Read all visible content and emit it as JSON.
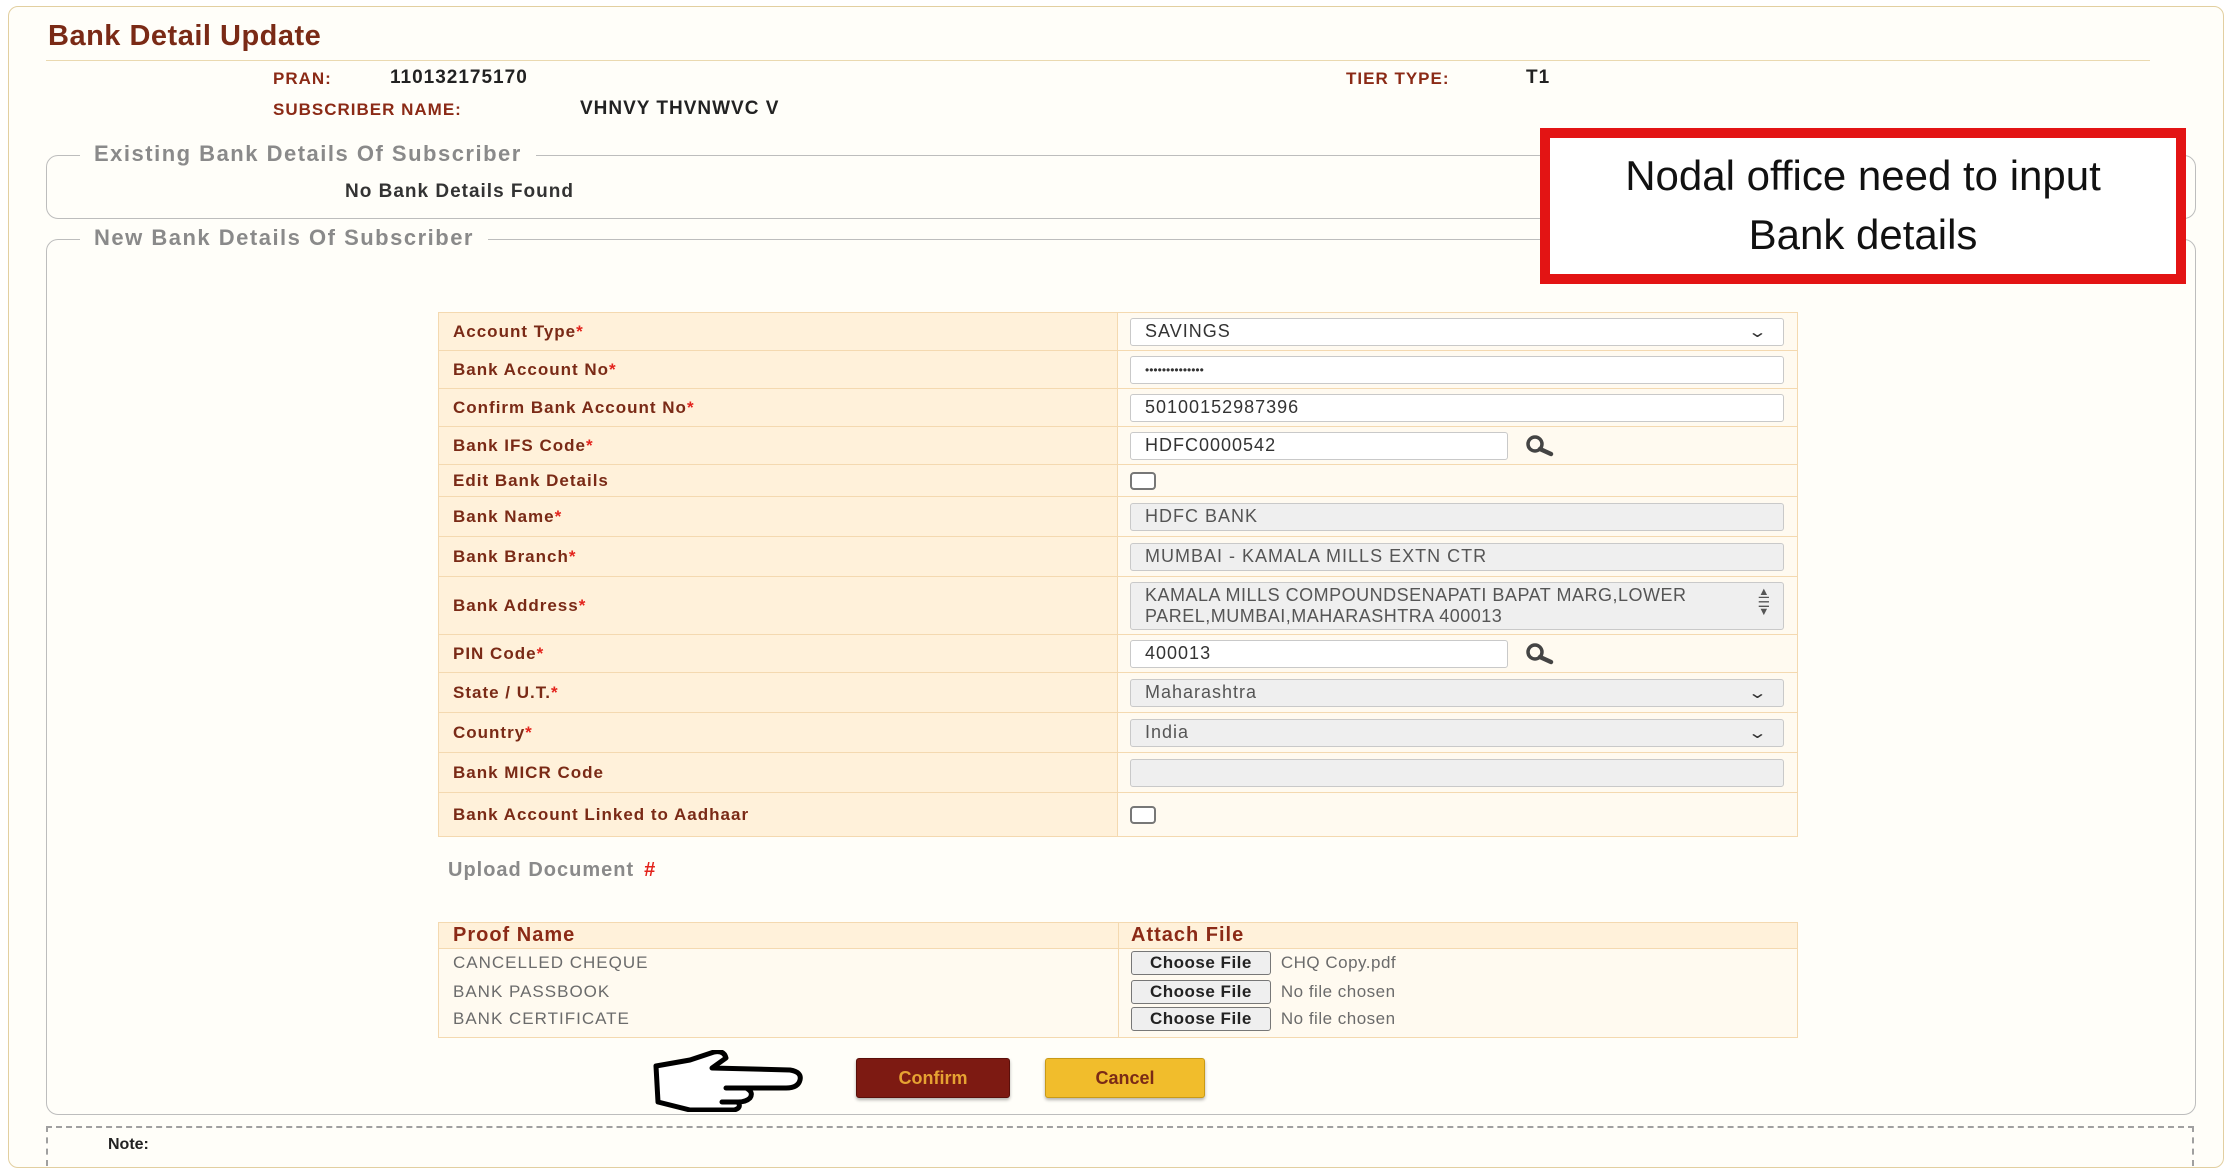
{
  "page": {
    "title": "Bank Detail Update"
  },
  "subscriber": {
    "pran_label": "PRAN:",
    "pran_value": "110132175170",
    "tier_label": "TIER TYPE:",
    "tier_value": "T1",
    "name_label": "SUBSCRIBER NAME:",
    "name_value": "VHNVY THVNWVC V"
  },
  "existing": {
    "legend": "Existing Bank Details Of Subscriber",
    "message": "No Bank Details Found"
  },
  "new_details": {
    "legend": "New Bank Details Of Subscriber"
  },
  "callout": {
    "text": "Nodal office need to input Bank details"
  },
  "form": {
    "account_type": {
      "label": "Account Type",
      "value": "SAVINGS"
    },
    "account_no": {
      "label": "Bank Account No",
      "value": "••••••••••••••"
    },
    "confirm_account_no": {
      "label": "Confirm Bank Account No",
      "value": "50100152987396"
    },
    "ifsc": {
      "label": "Bank IFS Code",
      "value": "HDFC0000542"
    },
    "edit_bank": {
      "label": "Edit Bank Details"
    },
    "bank_name": {
      "label": "Bank Name",
      "value": "HDFC BANK"
    },
    "bank_branch": {
      "label": "Bank Branch",
      "value": "MUMBAI - KAMALA MILLS EXTN CTR"
    },
    "bank_address": {
      "label": "Bank Address",
      "value": "KAMALA MILLS COMPOUNDSENAPATI BAPAT MARG,LOWER PAREL,MUMBAI,MAHARASHTRA 400013"
    },
    "pin": {
      "label": "PIN Code",
      "value": "400013"
    },
    "state": {
      "label": "State / U.T.",
      "value": "Maharashtra"
    },
    "country": {
      "label": "Country",
      "value": "India"
    },
    "micr": {
      "label": "Bank MICR Code",
      "value": ""
    },
    "aadhaar_linked": {
      "label": "Bank Account Linked to Aadhaar"
    },
    "required_mark": "*"
  },
  "upload": {
    "heading": "Upload Document",
    "mark": "#",
    "col_proof": "Proof Name",
    "col_attach": "Attach File",
    "choose_label": "Choose File",
    "rows": [
      {
        "proof": "CANCELLED CHEQUE",
        "file": "CHQ Copy.pdf"
      },
      {
        "proof": "BANK PASSBOOK",
        "file": "No file chosen"
      },
      {
        "proof": "BANK CERTIFICATE",
        "file": "No file chosen"
      }
    ]
  },
  "actions": {
    "confirm": "Confirm",
    "cancel": "Cancel"
  },
  "note": {
    "label": "Note:"
  },
  "icons": {
    "pointer": "pointing-hand-icon",
    "search": "magnifier-icon",
    "dropdown": "chevron-down-icon"
  }
}
